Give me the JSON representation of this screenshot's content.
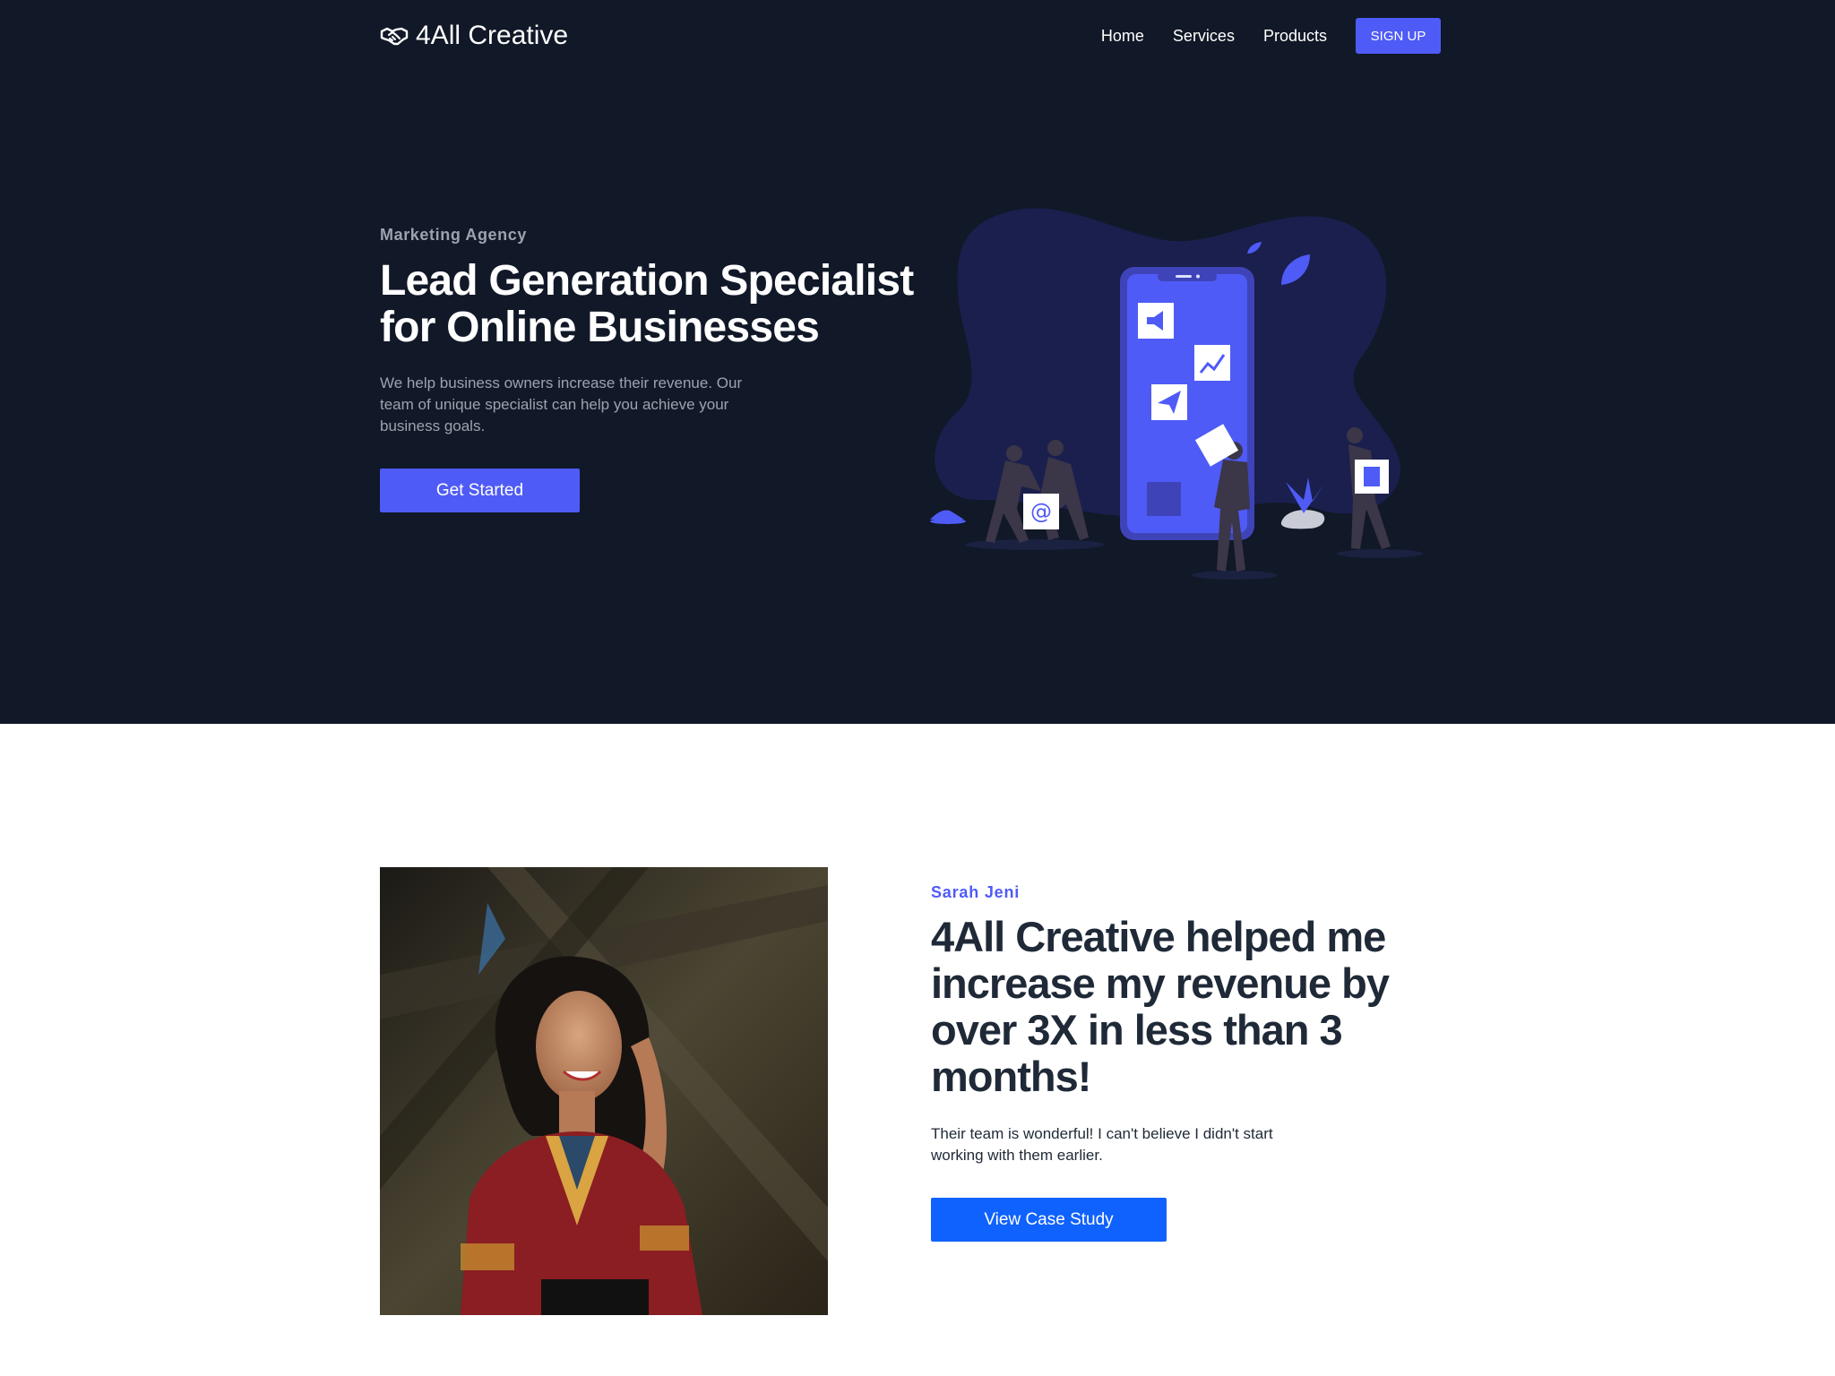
{
  "nav": {
    "brand": "4All Creative",
    "brand_icon": "handshake-icon",
    "links": [
      "Home",
      "Services",
      "Products"
    ],
    "signup_label": "SIGN UP"
  },
  "hero": {
    "eyebrow": "Marketing Agency",
    "title": "Lead Generation Specialist for Online Businesses",
    "text": "We help business owners increase their revenue. Our team of unique specialist can help you achieve your business goals.",
    "cta_label": "Get Started"
  },
  "testimonial": {
    "name": "Sarah Jeni",
    "quote": "4All Creative helped me increase my revenue by over 3X in less than 3 months!",
    "text": "Their team is wonderful! I can't believe I didn't start working with them earlier.",
    "cta_label": "View Case Study"
  },
  "colors": {
    "hero_background": "#111827",
    "accent": "#4f5bf6",
    "case_study_button": "#0f62fe"
  }
}
